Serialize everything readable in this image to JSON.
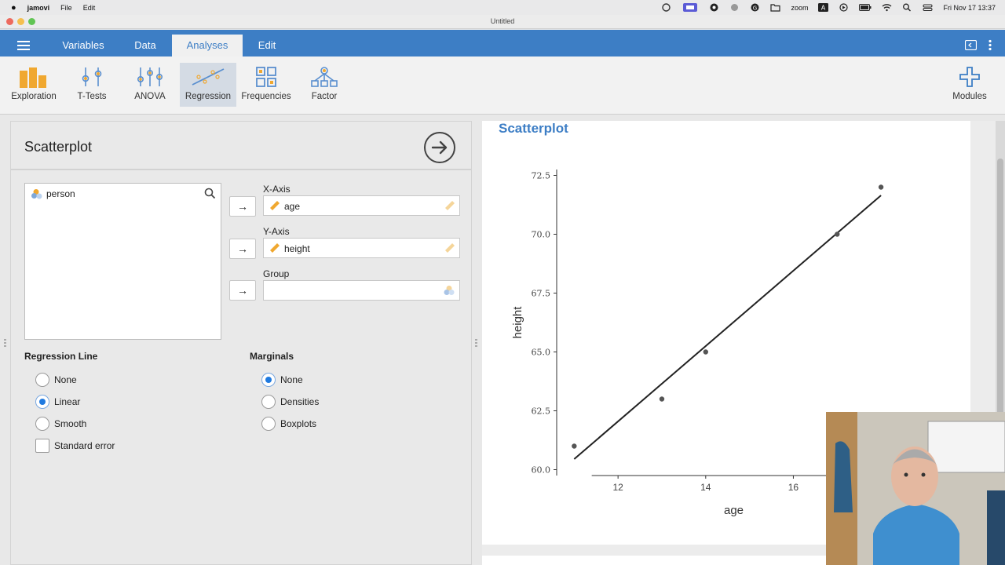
{
  "menubar": {
    "app_name": "jamovi",
    "items": [
      "File",
      "Edit"
    ],
    "status_items": [
      "zoom"
    ],
    "datetime": "Fri Nov 17  13:37"
  },
  "window": {
    "title": "Untitled"
  },
  "tabs": [
    {
      "label": "Variables"
    },
    {
      "label": "Data"
    },
    {
      "label": "Analyses",
      "active": true
    },
    {
      "label": "Edit"
    }
  ],
  "ribbon": {
    "buttons": [
      {
        "label": "Exploration",
        "icon": "exploration-icon"
      },
      {
        "label": "T-Tests",
        "icon": "t-tests-icon"
      },
      {
        "label": "ANOVA",
        "icon": "anova-icon"
      },
      {
        "label": "Regression",
        "icon": "regression-icon",
        "selected": true
      },
      {
        "label": "Frequencies",
        "icon": "frequencies-icon"
      },
      {
        "label": "Factor",
        "icon": "factor-icon"
      }
    ],
    "modules_label": "Modules"
  },
  "options": {
    "title": "Scatterplot",
    "variables": [
      "person"
    ],
    "x_axis_label": "X-Axis",
    "x_axis_value": "age",
    "y_axis_label": "Y-Axis",
    "y_axis_value": "height",
    "group_label": "Group",
    "group_value": "",
    "regression_line": {
      "heading": "Regression Line",
      "options": [
        "None",
        "Linear",
        "Smooth"
      ],
      "selected": "Linear",
      "standard_error_label": "Standard error",
      "standard_error_checked": false
    },
    "marginals": {
      "heading": "Marginals",
      "options": [
        "None",
        "Densities",
        "Boxplots"
      ],
      "selected": "None"
    }
  },
  "results": {
    "title": "Scatterplot"
  },
  "chart_data": {
    "type": "scatter",
    "xlabel": "age",
    "ylabel": "height",
    "x_ticks": [
      12,
      14,
      16
    ],
    "y_ticks": [
      "60.0",
      "62.5",
      "65.0",
      "67.5",
      "70.0",
      "72.5"
    ],
    "xlim": [
      10.6,
      18.5
    ],
    "ylim": [
      59.75,
      72.75
    ],
    "points": [
      {
        "x": 11,
        "y": 61
      },
      {
        "x": 13,
        "y": 63
      },
      {
        "x": 14,
        "y": 65
      },
      {
        "x": 17,
        "y": 70
      },
      {
        "x": 18,
        "y": 72
      }
    ],
    "regression_line": {
      "x0": 11,
      "y0": 60.45,
      "x1": 18,
      "y1": 71.65
    },
    "colors": {
      "points": "#555555",
      "line": "#222222"
    }
  },
  "colors": {
    "accent": "#3d7ec5",
    "radio_selected": "#1f7ae0",
    "variable_icon": "#f0a830"
  }
}
